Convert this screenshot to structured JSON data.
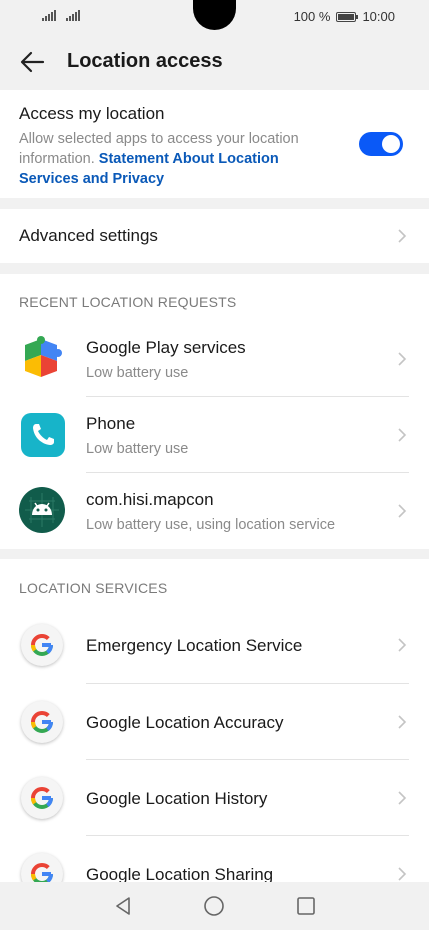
{
  "status_bar": {
    "battery_percent": "100 %",
    "time": "10:00"
  },
  "header": {
    "title": "Location access",
    "back_icon": "back-arrow-icon"
  },
  "access": {
    "title": "Access my location",
    "description": "Allow selected apps to access your location information.",
    "link_text": "Statement About Location Services and Privacy",
    "toggle_on": true,
    "accent_color": "#0a59f7"
  },
  "advanced": {
    "label": "Advanced settings"
  },
  "recent": {
    "header": "RECENT LOCATION REQUESTS",
    "items": [
      {
        "title": "Google Play services",
        "subtitle": "Low battery use",
        "icon": "google-play-services-icon"
      },
      {
        "title": "Phone",
        "subtitle": "Low battery use",
        "icon": "phone-app-icon"
      },
      {
        "title": "com.hisi.mapcon",
        "subtitle": "Low battery use, using location service",
        "icon": "android-icon"
      }
    ]
  },
  "services": {
    "header": "LOCATION SERVICES",
    "items": [
      {
        "title": "Emergency Location Service",
        "icon": "google-g-icon"
      },
      {
        "title": "Google Location Accuracy",
        "icon": "google-g-icon"
      },
      {
        "title": "Google Location History",
        "icon": "google-g-icon"
      },
      {
        "title": "Google Location Sharing",
        "icon": "google-g-icon"
      }
    ]
  },
  "nav_bar": {
    "buttons": [
      "back-triangle-icon",
      "home-circle-icon",
      "recents-square-icon"
    ]
  }
}
